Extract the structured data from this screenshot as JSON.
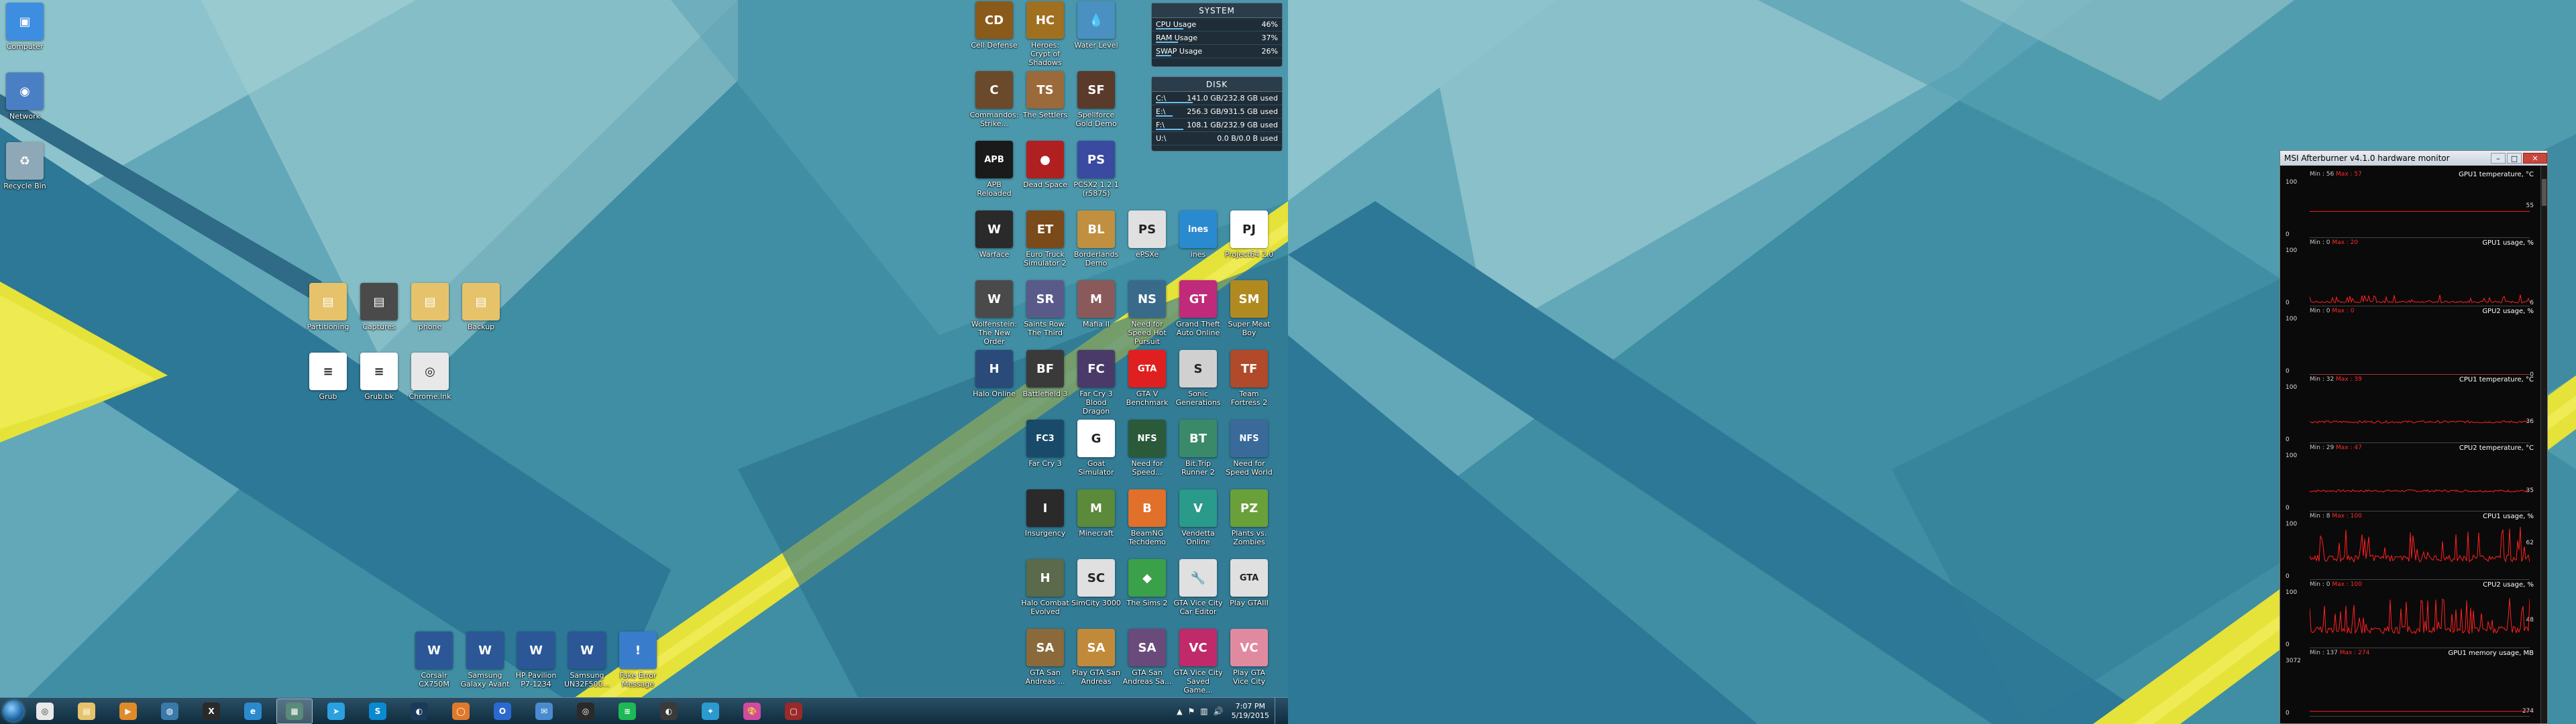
{
  "left_desktop": {
    "system_icons": [
      {
        "label": "Computer",
        "icon": "computer-icon",
        "color": "#3d8ee0",
        "glyph": "▣"
      },
      {
        "label": "Network",
        "icon": "network-icon",
        "color": "#4a7fc4",
        "glyph": "◉"
      },
      {
        "label": "Recycle Bin",
        "icon": "recycle-bin-icon",
        "color": "#8fa8b8",
        "glyph": "♻"
      }
    ],
    "folder_icons": [
      {
        "label": "Partitioning",
        "icon": "folder-icon",
        "color": "#e6c36a",
        "glyph": "▤"
      },
      {
        "label": "Captures",
        "icon": "folder-icon",
        "color": "#4a4a4a",
        "glyph": "▤"
      },
      {
        "label": "phone",
        "icon": "folder-icon",
        "color": "#e6c36a",
        "glyph": "▤"
      },
      {
        "label": "Backup",
        "icon": "folder-icon",
        "color": "#e6c36a",
        "glyph": "▤"
      },
      {
        "label": "Grub",
        "icon": "document-icon",
        "color": "#ffffff",
        "glyph": "≡"
      },
      {
        "label": "Grub.bk",
        "icon": "document-icon",
        "color": "#ffffff",
        "glyph": "≡"
      },
      {
        "label": "Chrome.lnk",
        "icon": "chrome-icon",
        "color": "#e8e8e8",
        "glyph": "◎"
      }
    ],
    "bottom_icons": [
      {
        "label": "Corsair CX750M",
        "icon": "word-document-icon",
        "color": "#2b5797",
        "glyph": "W"
      },
      {
        "label": "Samsung Galaxy Avant",
        "icon": "word-document-icon",
        "color": "#2b5797",
        "glyph": "W"
      },
      {
        "label": "HP Pavilion P7-1234",
        "icon": "word-document-icon",
        "color": "#2b5797",
        "glyph": "W"
      },
      {
        "label": "Samsung UN32F500...",
        "icon": "word-document-icon",
        "color": "#2b5797",
        "glyph": "W"
      },
      {
        "label": "Fake Error Message",
        "icon": "error-message-icon",
        "color": "#3a7ccc",
        "glyph": "!"
      }
    ],
    "game_icons": [
      [
        {
          "label": "Cell Defense",
          "color": "#8a5a1a",
          "glyph": "CD"
        },
        {
          "label": "Heroes: Crypt of Shadows",
          "color": "#a07020",
          "glyph": "HC"
        },
        {
          "label": "Water Level",
          "color": "#4a90c0",
          "glyph": "💧"
        }
      ],
      [
        {
          "label": "Commandos: Strike...",
          "color": "#6a4a2a",
          "glyph": "C"
        },
        {
          "label": "The Settlers",
          "color": "#9a6a3a",
          "glyph": "TS"
        },
        {
          "label": "Spellforce Gold Demo",
          "color": "#5a3a2a",
          "glyph": "SF"
        }
      ],
      [
        {
          "label": "APB Reloaded",
          "color": "#1a1a1a",
          "glyph": "APB"
        },
        {
          "label": "Dead Space",
          "color": "#b02020",
          "glyph": "●"
        },
        {
          "label": "PCSX2 1.2.1 (r5875)",
          "color": "#3a4aa0",
          "glyph": "PS"
        }
      ],
      [
        {
          "label": "Warface",
          "color": "#2a2a2a",
          "glyph": "W"
        },
        {
          "label": "Euro Truck Simulator 2",
          "color": "#7a4a1a",
          "glyph": "ET"
        },
        {
          "label": "Borderlands Demo",
          "color": "#c09040",
          "glyph": "BL"
        },
        {
          "label": "ePSXe",
          "color": "#e0e0e0",
          "glyph": "PS"
        },
        {
          "label": "ines",
          "color": "#2a8ad0",
          "glyph": "ines"
        },
        {
          "label": "Project64 2.0",
          "color": "#ffffff",
          "glyph": "PJ"
        }
      ],
      [
        {
          "label": "Wolfenstein: The New Order",
          "color": "#4a4a4a",
          "glyph": "W"
        },
        {
          "label": "Saints Row: The Third",
          "color": "#5a5a8a",
          "glyph": "SR"
        },
        {
          "label": "Mafia II",
          "color": "#8a5a5a",
          "glyph": "M"
        },
        {
          "label": "Need for Speed Hot Pursuit",
          "color": "#3a6a8a",
          "glyph": "NS"
        },
        {
          "label": "Grand Theft Auto Online",
          "color": "#c02a7a",
          "glyph": "GT"
        },
        {
          "label": "Super Meat Boy",
          "color": "#b08a20",
          "glyph": "SM"
        }
      ],
      [
        {
          "label": "Halo Online",
          "color": "#2a4a7a",
          "glyph": "H"
        },
        {
          "label": "Battlefield 3",
          "color": "#3a3a3a",
          "glyph": "BF"
        },
        {
          "label": "Far Cry 3 Blood Dragon",
          "color": "#4a3a6a",
          "glyph": "FC"
        },
        {
          "label": "GTA V Benchmark",
          "color": "#e02020",
          "glyph": "GTA"
        },
        {
          "label": "Sonic Generations",
          "color": "#d0d0d0",
          "glyph": "S"
        },
        {
          "label": "Team Fortress 2",
          "color": "#b04a2a",
          "glyph": "TF"
        }
      ],
      [
        {
          "label": "Far Cry 3",
          "color": "#1a4a6a",
          "glyph": "FC3"
        },
        {
          "label": "Goat Simulator",
          "color": "#ffffff",
          "glyph": "G"
        },
        {
          "label": "Need for Speed...",
          "color": "#2a5a3a",
          "glyph": "NFS"
        },
        {
          "label": "Bit.Trip Runner 2",
          "color": "#3a8a6a",
          "glyph": "BT"
        },
        {
          "label": "Need for Speed World",
          "color": "#3a6a9a",
          "glyph": "NFS"
        }
      ],
      [
        {
          "label": "Insurgency",
          "color": "#2a2a2a",
          "glyph": "I"
        },
        {
          "label": "Minecraft",
          "color": "#5a8a3a",
          "glyph": "M"
        },
        {
          "label": "BeamNG Techdemo",
          "color": "#e0702a",
          "glyph": "B"
        },
        {
          "label": "Vendetta Online",
          "color": "#2a9a8a",
          "glyph": "V"
        },
        {
          "label": "Plants vs. Zombies",
          "color": "#6aa03a",
          "glyph": "PZ"
        }
      ],
      [
        {
          "label": "Halo Combat Evolved",
          "color": "#5a6a4a",
          "glyph": "H"
        },
        {
          "label": "SimCity 3000",
          "color": "#e0e0e0",
          "glyph": "SC"
        },
        {
          "label": "The Sims 2",
          "color": "#3aa04a",
          "glyph": "◆"
        },
        {
          "label": "GTA Vice City Car Editor",
          "color": "#e0e0e0",
          "glyph": "🔧"
        },
        {
          "label": "Play GTAIII",
          "color": "#e0e0e0",
          "glyph": "GTA"
        }
      ],
      [
        {
          "label": "GTA San Andreas ...",
          "color": "#8a6a3a",
          "glyph": "SA"
        },
        {
          "label": "Play GTA San Andreas",
          "color": "#c08a3a",
          "glyph": "SA"
        },
        {
          "label": "GTA San Andreas Sa...",
          "color": "#6a4a7a",
          "glyph": "SA"
        },
        {
          "label": "GTA Vice City Saved Game...",
          "color": "#c02a6a",
          "glyph": "VC"
        },
        {
          "label": "Play GTA Vice City",
          "color": "#e08aa0",
          "glyph": "VC"
        }
      ]
    ],
    "system_gadget": {
      "title": "SYSTEM",
      "rows": [
        {
          "label": "CPU Usage",
          "value": "46%",
          "pct": 46
        },
        {
          "label": "RAM Usage",
          "value": "37%",
          "pct": 37
        },
        {
          "label": "SWAP Usage",
          "value": "26%",
          "pct": 26
        }
      ]
    },
    "disk_gadget": {
      "title": "DISK",
      "rows": [
        {
          "label": "C:\\",
          "value": "141.0 GB/232.8 GB used",
          "pct": 61
        },
        {
          "label": "E:\\",
          "value": "256.3 GB/931.5 GB used",
          "pct": 28
        },
        {
          "label": "F:\\",
          "value": "108.1 GB/232.9 GB used",
          "pct": 46
        },
        {
          "label": "U:\\",
          "value": "0.0 B/0.0 B used",
          "pct": 0
        }
      ]
    }
  },
  "taskbar": {
    "apps": [
      {
        "name": "chrome",
        "icon": "chrome-icon",
        "color": "#e8e8e8",
        "glyph": "◎"
      },
      {
        "name": "explorer",
        "icon": "folder-icon",
        "color": "#e6c36a",
        "glyph": "▤"
      },
      {
        "name": "media-player",
        "icon": "media-player-icon",
        "color": "#e08a2a",
        "glyph": "▶"
      },
      {
        "name": "steam-big",
        "icon": "globe-icon",
        "color": "#3a7aaa",
        "glyph": "◍"
      },
      {
        "name": "xmind",
        "icon": "app-icon",
        "color": "#2a2a2a",
        "glyph": "X"
      },
      {
        "name": "ie",
        "icon": "globe-icon",
        "color": "#2a8ad0",
        "glyph": "e"
      },
      {
        "name": "explorer-active",
        "icon": "window-icon",
        "color": "#5a8a7a",
        "glyph": "▦"
      },
      {
        "name": "telegram",
        "icon": "telegram-icon",
        "color": "#2aa0e0",
        "glyph": "➤"
      },
      {
        "name": "skype",
        "icon": "skype-icon",
        "color": "#0a8ad0",
        "glyph": "S"
      },
      {
        "name": "steam",
        "icon": "steam-icon",
        "color": "#1a3a5a",
        "glyph": "◐"
      },
      {
        "name": "origin",
        "icon": "origin-icon",
        "color": "#e07a2a",
        "glyph": "◯"
      },
      {
        "name": "outlook",
        "icon": "outlook-icon",
        "color": "#2a6ad0",
        "glyph": "O"
      },
      {
        "name": "mail",
        "icon": "mail-icon",
        "color": "#4a8ad0",
        "glyph": "✉"
      },
      {
        "name": "obs",
        "icon": "obs-icon",
        "color": "#2a2a2a",
        "glyph": "◎"
      },
      {
        "name": "spotify",
        "icon": "spotify-icon",
        "color": "#1db954",
        "glyph": "≋"
      },
      {
        "name": "steam2",
        "icon": "steam-icon",
        "color": "#3a3a3a",
        "glyph": "◐"
      },
      {
        "name": "kodi",
        "icon": "kodi-icon",
        "color": "#2a9ad0",
        "glyph": "✦"
      },
      {
        "name": "paint",
        "icon": "paint-icon",
        "color": "#d04aa0",
        "glyph": "🎨"
      },
      {
        "name": "afterburner",
        "icon": "afterburner-icon",
        "color": "#9a2a2a",
        "glyph": "▢"
      }
    ],
    "time": "7:07 PM",
    "date": "5/19/2015"
  },
  "afterburner": {
    "title": "MSI Afterburner v4.1.0 hardware monitor",
    "graphs": [
      {
        "name": "GPU1 temperature, °C",
        "min": "Min : 56",
        "max": "Max : 57",
        "ytop": "100",
        "ybot": "0",
        "cur": "55",
        "curpos": 0.45,
        "color": "#ff2020",
        "kind": "flat",
        "level": 0.45
      },
      {
        "name": "GPU1 usage, %",
        "min": "Min : 0",
        "max": "Max : 20",
        "ytop": "100",
        "ybot": "0",
        "cur": "6",
        "curpos": 0.94,
        "color": "#ff2020",
        "kind": "noisy-low",
        "level": 0.06
      },
      {
        "name": "GPU2 usage, %",
        "min": "Min : 0",
        "max": "Max : 0",
        "ytop": "100",
        "ybot": "0",
        "cur": "0",
        "curpos": 1,
        "color": "#ff2020",
        "kind": "flat",
        "level": 0
      },
      {
        "name": "CPU1 temperature, °C",
        "min": "Min : 32",
        "max": "Max : 39",
        "ytop": "100",
        "ybot": "0",
        "cur": "36",
        "curpos": 0.64,
        "color": "#ff2020",
        "kind": "noisy-flat",
        "level": 0.36
      },
      {
        "name": "CPU2 temperature, °C",
        "min": "Min : 29",
        "max": "Max : 47",
        "ytop": "100",
        "ybot": "0",
        "cur": "35",
        "curpos": 0.65,
        "color": "#ff2020",
        "kind": "noisy-flat",
        "level": 0.35
      },
      {
        "name": "CPU1 usage, %",
        "min": "Min : 8",
        "max": "Max : 100",
        "ytop": "100",
        "ybot": "0",
        "cur": "62",
        "curpos": 0.38,
        "color": "#ff2020",
        "kind": "spiky",
        "level": 0.35
      },
      {
        "name": "CPU2 usage, %",
        "min": "Min : 0",
        "max": "Max : 100",
        "ytop": "100",
        "ybot": "0",
        "cur": "48",
        "curpos": 0.52,
        "color": "#ff2020",
        "kind": "spiky",
        "level": 0.3
      },
      {
        "name": "GPU1 memory usage, MB",
        "min": "Min : 137",
        "max": "Max : 274",
        "ytop": "3072",
        "ybot": "0",
        "cur": "274",
        "curpos": 0.91,
        "color": "#ff2020",
        "kind": "flat",
        "level": 0.09
      }
    ]
  }
}
